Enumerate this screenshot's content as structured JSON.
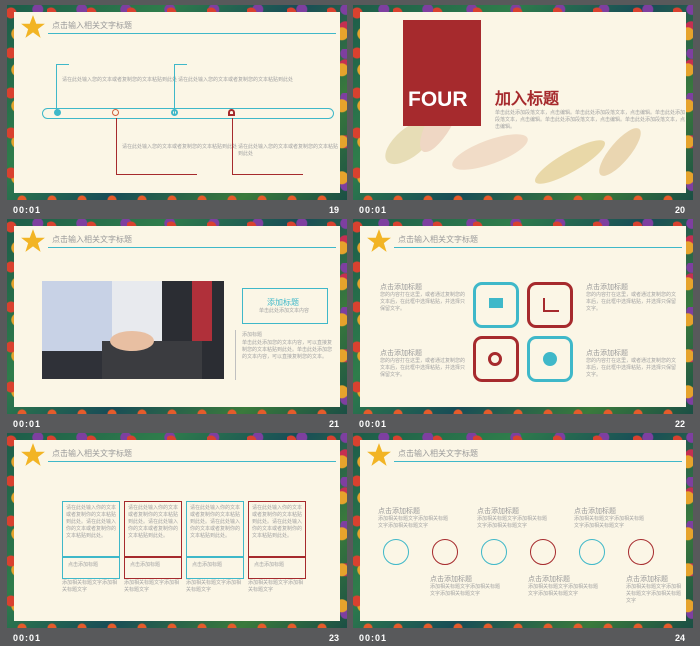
{
  "header_title": "点击输入相关文字标题",
  "time": "00:01",
  "slides": {
    "s19": {
      "number": "19",
      "text_top_left": "请在此处输入您的文本或者复制您的文本粘贴到此处",
      "text_top_right": "请在此处输入您的文本或者复制您的文本粘贴到此处",
      "text_bottom_left": "请在此处输入您的文本或者复制您的文本粘贴到此处",
      "text_bottom_right": "请在此处输入您的文本或者复制您的文本粘贴到此处"
    },
    "s20": {
      "number": "20",
      "section": "FOUR",
      "title": "加入标题",
      "body": "单击此处添加段落文本，点击编辑。单击此处添加段落文本，点击编辑。单击此处添加段落文本，点击编辑。单击此处添加段落文本，点击编辑。单击此处添加段落文本，点击编辑。"
    },
    "s21": {
      "number": "21",
      "box_title": "添加标题",
      "box_sub": "单击此处添加文本内容",
      "label": "添加标题",
      "body": "单击此处添加您的文本内容，可以直接复制您的文本粘贴到此处。单击此处添加您的文本内容，可以直接复制您的文本。"
    },
    "s22": {
      "number": "22",
      "titles": [
        "点击添加标题",
        "点击添加标题",
        "点击添加标题",
        "点击添加标题"
      ],
      "body": "您的内容打在这里，或者通过复制您的文本后，在此框中选择粘贴，并选择只保留文字。"
    },
    "s23": {
      "number": "23",
      "box_text": "请在此处输入你的文本或者复制你的文本粘贴到此处。请在此处输入你的文本或者复制你的文本粘贴到此处。",
      "labels": [
        "点击添加标题",
        "点击添加标题",
        "点击添加标题",
        "点击添加标题"
      ],
      "sub": "添加相关标题文字添加相关标题文字"
    },
    "s24": {
      "number": "24",
      "title": "点击添加标题",
      "sub": "添加相关标题文字添加相关标题文字添加相关标题文字"
    }
  },
  "colors": {
    "teal": "#3fb8c9",
    "red": "#a62a2d",
    "cream": "#fbf6e6"
  }
}
